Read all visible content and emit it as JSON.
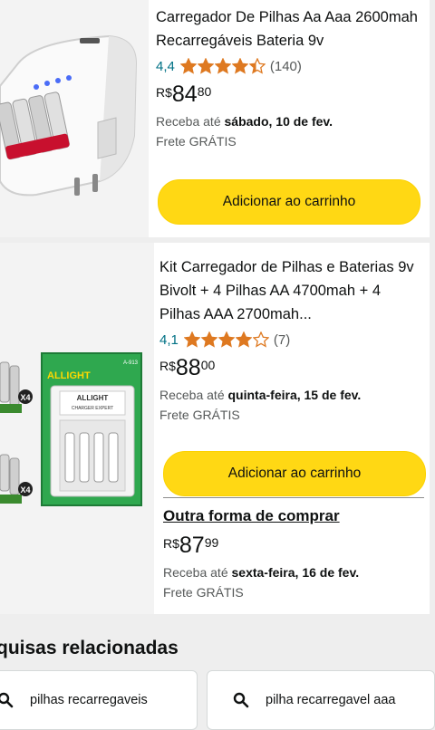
{
  "products": [
    {
      "title": "Carregador De Pilhas Aa Aaa 2600mah Recarregáveis Bateria 9v",
      "rating": "4,4",
      "stars": 4.4,
      "review_count": "(140)",
      "price_currency": "R$",
      "price_whole": "84",
      "price_cents": "80",
      "delivery_prefix": "Receba até ",
      "delivery_date": "sábado, 10 de fev.",
      "shipping": "Frete GRÁTIS",
      "add_to_cart": "Adicionar ao carrinho"
    },
    {
      "title": "Kit Carregador de Pilhas e Baterias 9v Bivolt + 4 Pilhas AA 4700mah + 4 Pilhas AAA 2700mah...",
      "rating": "4,1",
      "stars": 4.1,
      "review_count": "(7)",
      "price_currency": "R$",
      "price_whole": "88",
      "price_cents": "00",
      "delivery_prefix": "Receba até ",
      "delivery_date": "quinta-feira, 15 de fev.",
      "shipping": "Frete GRÁTIS",
      "add_to_cart": "Adicionar ao carrinho",
      "other_offer": {
        "title": "Outra forma de comprar",
        "price_currency": "R$",
        "price_whole": "87",
        "price_cents": "99",
        "delivery_prefix": "Receba até ",
        "delivery_date": "sexta-feira, 16 de fev.",
        "shipping": "Frete GRÁTIS"
      }
    }
  ],
  "image_labels": {
    "brand": "ALLIGHT",
    "model": "CHARGER EXPERT",
    "sku": "A-913",
    "multiplier": "X4"
  },
  "related": {
    "title": "quisas relacionadas",
    "searches": [
      "pilhas recarregaveis",
      "pilha recarregavel aaa"
    ]
  },
  "colors": {
    "button": "#ffd814",
    "star": "#de7921",
    "link": "#007185"
  }
}
